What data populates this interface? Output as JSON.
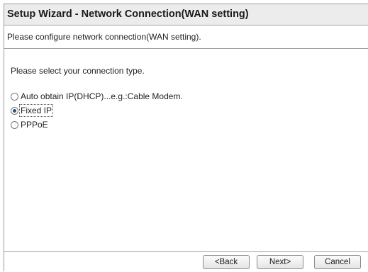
{
  "header": {
    "title": "Setup Wizard - Network Connection(WAN setting)",
    "subtitle": "Please configure network connection(WAN setting)."
  },
  "main": {
    "prompt": "Please select your connection type.",
    "options": [
      {
        "label": "Auto obtain IP(DHCP)...e.g.:Cable Modem.",
        "checked": false
      },
      {
        "label": "Fixed IP",
        "checked": true
      },
      {
        "label": "PPPoE",
        "checked": false
      }
    ]
  },
  "footer": {
    "back_label": "<Back",
    "next_label": "Next>",
    "cancel_label": "Cancel"
  }
}
